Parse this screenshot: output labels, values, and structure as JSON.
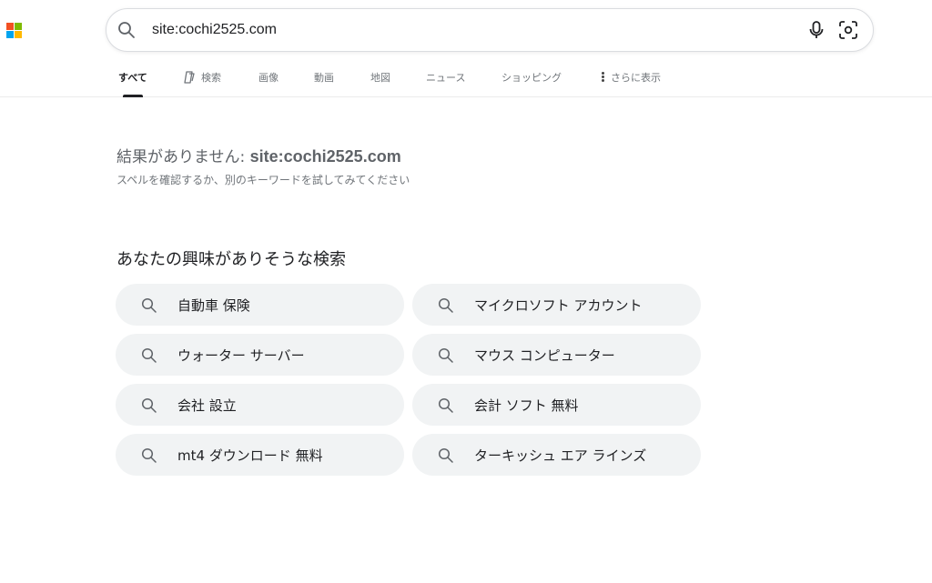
{
  "logo": {
    "colors": [
      "#f25022",
      "#7fba00",
      "#00a4ef",
      "#ffb900"
    ]
  },
  "search": {
    "value": "site:cochi2525.com",
    "icon": "search-icon",
    "mic_icon": "microphone-icon",
    "visual_search_icon": "visual-search-icon"
  },
  "tabs": [
    {
      "label": "すべて",
      "active": true
    },
    {
      "label": "検索",
      "icon": "copilot-icon"
    },
    {
      "label": "画像"
    },
    {
      "label": "動画"
    },
    {
      "label": "地図"
    },
    {
      "label": "ニュース"
    },
    {
      "label": "ショッピング"
    },
    {
      "label": "さらに表示",
      "icon": "more-vertical-icon"
    }
  ],
  "results": {
    "no_results_prefix": "結果がありません: ",
    "query": "site:cochi2525.com",
    "suggestion": "スペルを確認するか、別のキーワードを試してみてください"
  },
  "related": {
    "heading": "あなたの興味がありそうな検索",
    "items": [
      "自動車 保険",
      "マイクロソフト アカウント",
      "ウォーター サーバー",
      "マウス コンピューター",
      "会社 設立",
      "会計 ソフト 無料",
      "mt4 ダウンロード 無料",
      "ターキッシュ エア ラインズ"
    ]
  },
  "colors": {
    "chip_bg": "#f1f3f4",
    "active_tab": "#202124",
    "muted_text": "#70757a"
  }
}
